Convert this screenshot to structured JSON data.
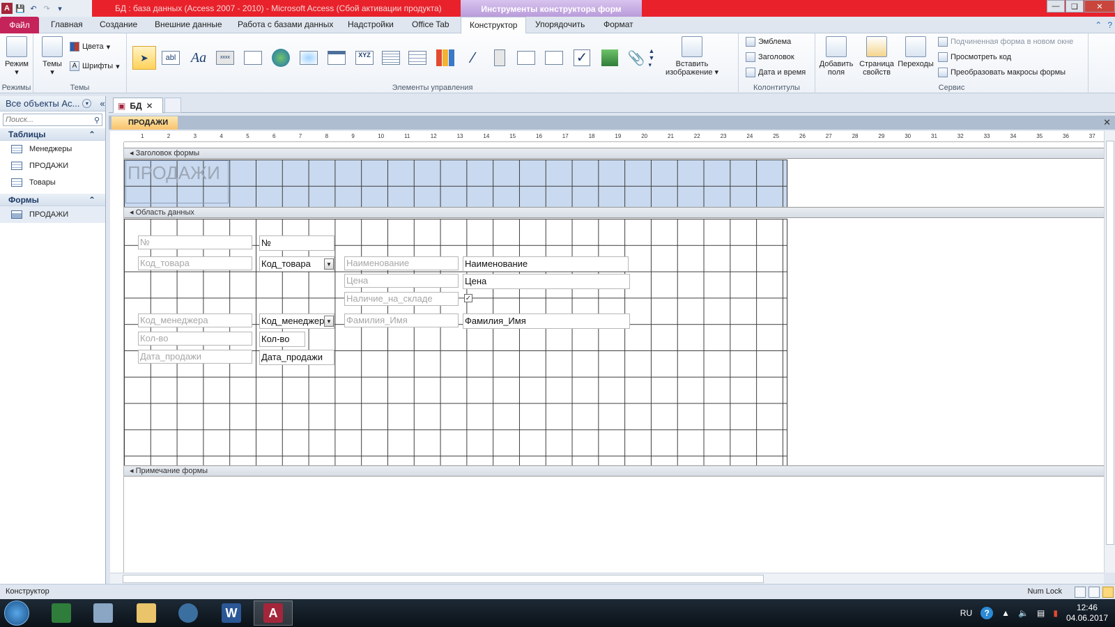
{
  "titlebar": {
    "title": "БД : база данных (Access 2007 - 2010)  -  Microsoft Access (Сбой активации продукта)",
    "context_tab_title": "Инструменты конструктора форм"
  },
  "tabs": {
    "file": "Файл",
    "items": [
      "Главная",
      "Создание",
      "Внешние данные",
      "Работа с базами данных",
      "Надстройки",
      "Office Tab",
      "Конструктор",
      "Упорядочить",
      "Формат"
    ],
    "active": "Конструктор"
  },
  "ribbon": {
    "views": {
      "button": "Режим",
      "label": "Режимы"
    },
    "themes": {
      "button": "Темы",
      "colors": "Цвета",
      "fonts": "Шрифты",
      "label": "Темы"
    },
    "controls": {
      "label": "Элементы управления",
      "insert_image": "Вставить изображение"
    },
    "header_footer": {
      "logo": "Эмблема",
      "title": "Заголовок",
      "date_time": "Дата и время",
      "label": "Колонтитулы"
    },
    "tools": {
      "add_fields": "Добавить поля",
      "property_sheet": "Страница свойств",
      "tab_order": "Переходы",
      "subform_new_window": "Подчиненная форма в новом окне",
      "view_code": "Просмотреть код",
      "convert_macros": "Преобразовать макросы формы",
      "label": "Сервис"
    }
  },
  "nav": {
    "header": "Все объекты Ac...",
    "search_placeholder": "Поиск...",
    "tables_label": "Таблицы",
    "tables": [
      "Менеджеры",
      "ПРОДАЖИ",
      "Товары"
    ],
    "forms_label": "Формы",
    "forms": [
      "ПРОДАЖИ"
    ]
  },
  "doc": {
    "tab_label": "БД",
    "form_tab": "ПРОДАЖИ"
  },
  "ruler": {
    "marks": [
      "1",
      "2",
      "3",
      "4",
      "5",
      "6",
      "7",
      "8",
      "9",
      "10",
      "11",
      "12",
      "13",
      "14",
      "15",
      "16",
      "17",
      "18",
      "19",
      "20",
      "21",
      "22",
      "23",
      "24",
      "25",
      "26",
      "27",
      "28",
      "29",
      "30",
      "31",
      "32",
      "33",
      "34",
      "35",
      "36",
      "37"
    ]
  },
  "form": {
    "header_section": "Заголовок формы",
    "title": "ПРОДАЖИ",
    "detail_section": "Область данных",
    "footer_section": "Примечание формы",
    "labels": {
      "no": "№",
      "product_code": "Код_товара",
      "name": "Наименование",
      "price": "Цена",
      "in_stock": "Наличие_на_складе",
      "manager_code": "Код_менеджера",
      "surname": "Фамилия_Имя",
      "qty": "Кол-во",
      "sale_date": "Дата_продажи"
    },
    "fields": {
      "no": "№",
      "product_code": "Код_товара",
      "name": "Наименование",
      "price": "Цена",
      "manager_code": "Код_менеджера",
      "surname": "Фамилия_Имя",
      "qty": "Кол-во",
      "sale_date": "Дата_продажи"
    }
  },
  "status": {
    "mode": "Конструктор",
    "numlock": "Num Lock"
  },
  "taskbar": {
    "lang": "RU",
    "time": "12:46",
    "date": "04.06.2017"
  },
  "colors": {
    "title_bar": "#e8212b",
    "file_tab": "#c4245a",
    "header_grid": "#c9d9ef",
    "active_form_tab": "#f8c26a"
  }
}
